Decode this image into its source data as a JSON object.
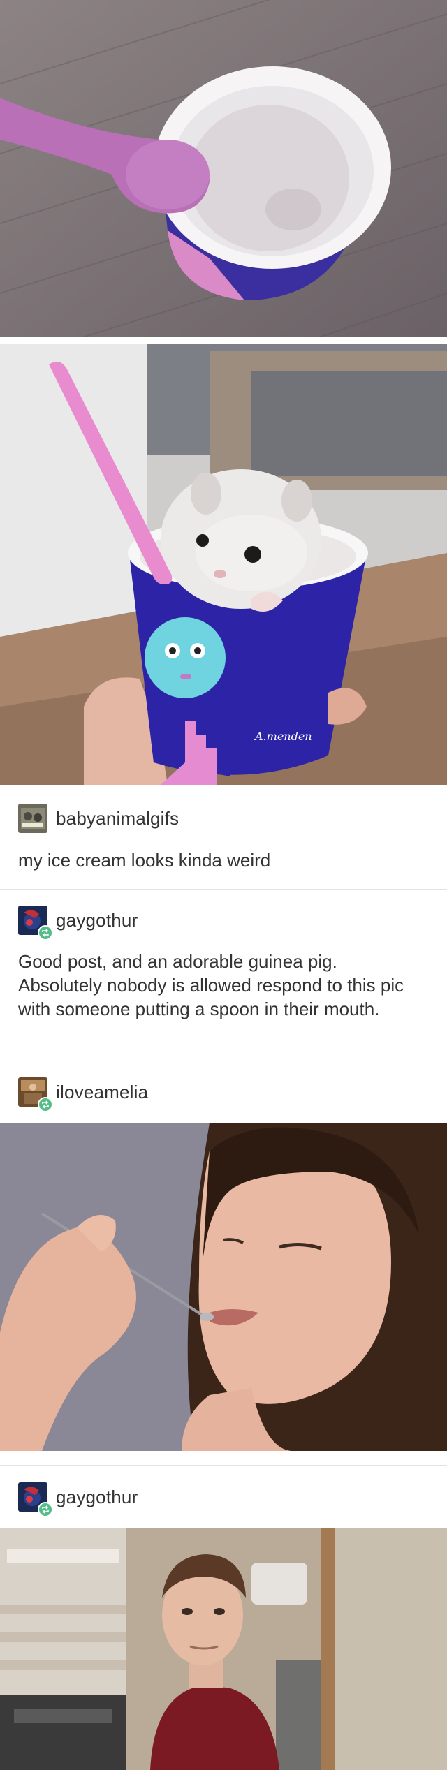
{
  "photo1": {
    "description": "hamster in ice cream cup with pink spoon",
    "icon": "hamster-cup-image"
  },
  "photo2": {
    "icon": "hamster-cup-held-image",
    "cup_text": "A.menden"
  },
  "posts": [
    {
      "username": "babyanimalgifs",
      "text": "my ice cream looks kinda weird",
      "reblog": false
    },
    {
      "username": "gaygothur",
      "text": "Good post, and an adorable guinea pig. Absolutely nobody is allowed respond to this pic with someone putting a spoon in their mouth.",
      "reblog": true
    },
    {
      "username": "iloveamelia",
      "text": "",
      "reblog": true
    },
    {
      "username": "gaygothur",
      "text": "",
      "reblog": true
    }
  ],
  "colors": {
    "reblog_green": "#56bc8a",
    "divider": "#e4e4e4",
    "text": "#333333"
  }
}
